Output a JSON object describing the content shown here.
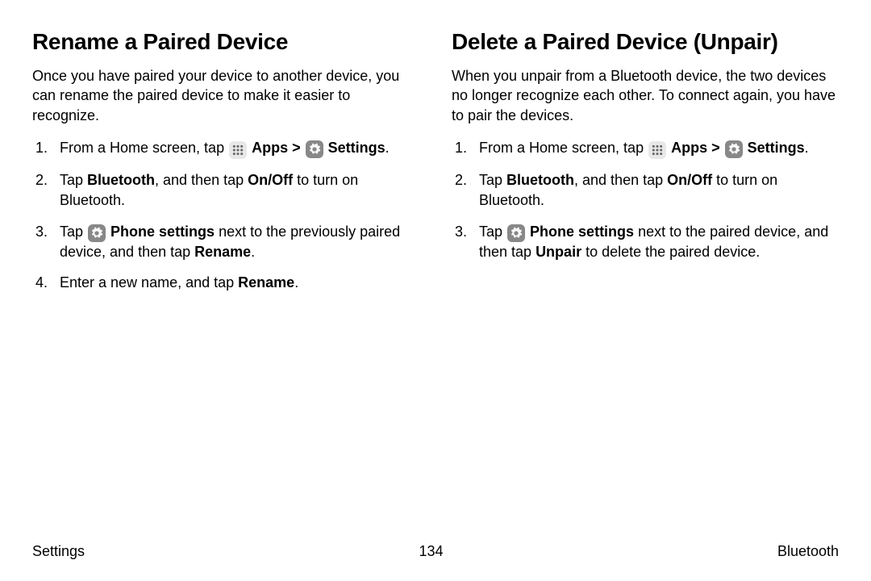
{
  "left": {
    "title": "Rename a Paired Device",
    "intro": "Once you have paired your device to another device, you can rename the paired device to make it easier to recognize.",
    "steps": {
      "s1_pre": "From a Home screen, tap ",
      "s1_apps": "Apps",
      "s1_sep": " > ",
      "s1_settings": "Settings",
      "s1_end": ".",
      "s2_a": "Tap ",
      "s2_b": "Bluetooth",
      "s2_c": ", and then tap ",
      "s2_d": "On/Off",
      "s2_e": " to turn on Bluetooth.",
      "s3_a": "Tap ",
      "s3_b": "Phone settings",
      "s3_c": " next to the previously paired device, and then tap ",
      "s3_d": "Rename",
      "s3_e": ".",
      "s4_a": "Enter a new name, and tap ",
      "s4_b": "Rename",
      "s4_c": "."
    }
  },
  "right": {
    "title": "Delete a Paired Device (Unpair)",
    "intro": "When you unpair from a Bluetooth device, the two devices no longer recognize each other. To connect again, you have to pair the devices.",
    "steps": {
      "s1_pre": "From a Home screen, tap ",
      "s1_apps": "Apps",
      "s1_sep": " > ",
      "s1_settings": "Settings",
      "s1_end": ".",
      "s2_a": "Tap ",
      "s2_b": "Bluetooth",
      "s2_c": ", and then tap ",
      "s2_d": "On/Off",
      "s2_e": " to turn on Bluetooth.",
      "s3_a": "Tap ",
      "s3_b": "Phone settings",
      "s3_c": " next to the paired device, and then tap ",
      "s3_d": "Unpair",
      "s3_e": " to delete the paired device."
    }
  },
  "footer": {
    "left": "Settings",
    "center": "134",
    "right": "Bluetooth"
  }
}
